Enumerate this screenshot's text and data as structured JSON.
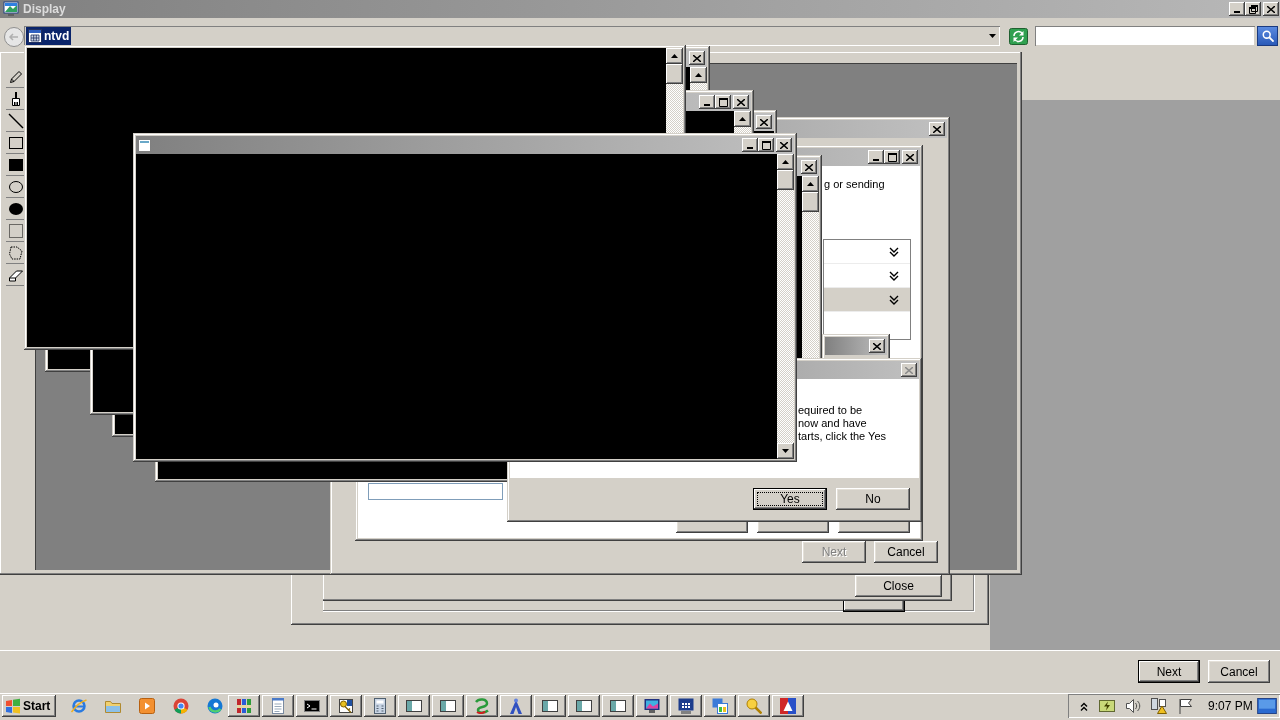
{
  "window": {
    "title": "Display"
  },
  "address_bar": {
    "caption": "ntvd"
  },
  "dialog": {
    "text": "g or sending",
    "list_rows": [
      {
        "selected": false
      },
      {
        "selected": false
      },
      {
        "selected": true
      }
    ]
  },
  "message_box": {
    "close_disabled": true,
    "lines": [
      "equired to be",
      "now and have",
      "tarts, click the Yes"
    ],
    "buttons": [
      {
        "label": "Yes",
        "focused": true
      },
      {
        "label": "No",
        "focused": false
      }
    ]
  },
  "wizard": {
    "buttons": [
      {
        "label": "Next",
        "disabled": true
      },
      {
        "label": "Cancel",
        "disabled": false
      }
    ]
  },
  "property_sheet": {
    "close_button": "Close"
  },
  "footer": {
    "buttons": [
      {
        "label": "Next",
        "default": true
      },
      {
        "label": "Cancel",
        "default": false
      }
    ]
  },
  "taskbar": {
    "start": "Start",
    "clock": "9:07 PM"
  }
}
